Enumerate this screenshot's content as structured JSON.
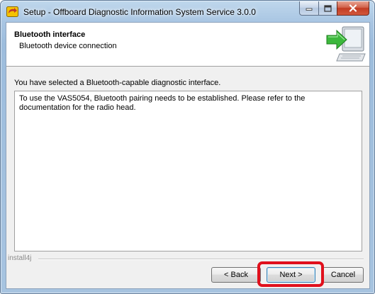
{
  "window": {
    "title": "Setup - Offboard Diagnostic Information System Service 3.0.0"
  },
  "header": {
    "title": "Bluetooth interface",
    "subtitle": "Bluetooth device connection"
  },
  "main": {
    "info_text": "You have selected a Bluetooth-capable diagnostic interface.",
    "text_area_line1": "To use the VAS5054, Bluetooth pairing needs to be established. Please refer to the",
    "text_area_line2": "documentation for the radio head."
  },
  "footer": {
    "brand": "install4j",
    "back_label": "< Back",
    "next_label": "Next >",
    "cancel_label": "Cancel"
  },
  "colors": {
    "highlight": "#e0101c",
    "close_button": "#c13c23",
    "header_arrow": "#3cb83c"
  }
}
